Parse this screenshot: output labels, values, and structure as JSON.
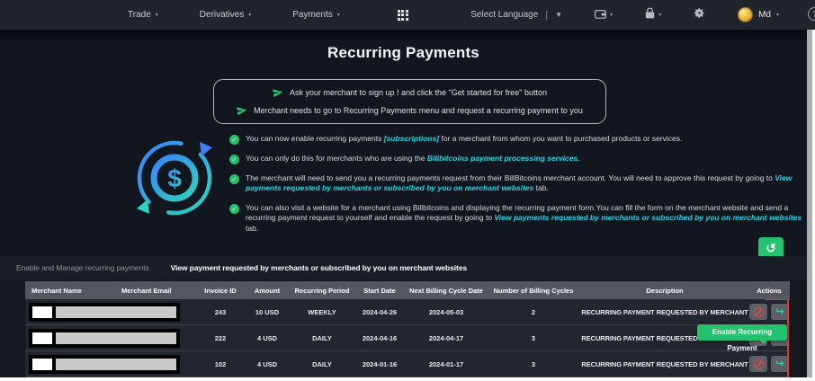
{
  "colors": {
    "accent_cyan": "#1fd5e8",
    "green": "#25c16f",
    "red": "#e24b4b",
    "navbar_bg": "#20252c",
    "main_bg": "#12161f",
    "table_header_bg": "#54585e",
    "row_bg": "#22262e"
  },
  "icons": {
    "apps-grid-icon": "3x3-grid",
    "wallet-icon": "wallet",
    "lock-icon": "padlock",
    "settings-gear-icon": "gear",
    "help-icon": "question-circle",
    "paper-plane-icon": "paper-plane",
    "check-icon": "✓",
    "history-icon": "↺",
    "ban-icon": "⊘",
    "forward-arrow-icon": "↪",
    "recurring-dollar-icon": "dollar-cycle",
    "caret-down-icon": "▾"
  },
  "navbar": {
    "items": [
      {
        "label": "Trade"
      },
      {
        "label": "Derivatives"
      },
      {
        "label": "Payments"
      }
    ],
    "language_label": "Select Language",
    "language_divider": "|",
    "user_label": "Md",
    "help_label": "?"
  },
  "page": {
    "title": "Recurring Payments"
  },
  "infobox": {
    "lines": [
      "Ask your merchant to sign up ! and click the \"Get started for free\" button",
      "Merchant needs to go to Recurring Payments menu and request a recurring payment to you"
    ]
  },
  "bullets": [
    {
      "segments": [
        {
          "text": "You can now enable recurring payments "
        },
        {
          "text": "[subscriptions]",
          "accent": true
        },
        {
          "text": " for a merchant from whom you want to purchased products or services."
        }
      ]
    },
    {
      "segments": [
        {
          "text": "You can only do this for merchants who are using the "
        },
        {
          "text": "Billbitcoins payment processing services.",
          "accent": true
        },
        {
          "text": ""
        }
      ]
    },
    {
      "segments": [
        {
          "text": "The merchant will need to send you a recurring payments request from their BillBitcoins merchant account. You will need to approve this request by going to "
        },
        {
          "text": "View payments requested by merchants or subscribed by you on merchant websites",
          "accent": true
        },
        {
          "text": " tab."
        }
      ]
    },
    {
      "segments": [
        {
          "text": "You can also visit a website for a merchant using Billbitcoins and displaying the recurring payment form.You can fill the form on the merchant website and send a recurring payment request to yourself and enable the request by going to "
        },
        {
          "text": "View payments requested by merchants or subscribed by you on merchant websites",
          "accent": true
        },
        {
          "text": " tab."
        }
      ]
    }
  ],
  "tabs": [
    {
      "label": "Enable and Manage recurring payments"
    },
    {
      "label": "View payment requested by merchants or subscribed by you on merchant websites"
    }
  ],
  "tooltip": {
    "text": "Enable Recurring Payment"
  },
  "table": {
    "headers": [
      "Merchant Name",
      "Merchant Email",
      "Invoice ID",
      "Amount",
      "Recurring Period",
      "Start Date",
      "Next Billing Cycle Date",
      "Number of Billing Cycles",
      "Description",
      "Actions"
    ],
    "rows": [
      {
        "merchant_name": "",
        "merchant_email": "",
        "redacted": true,
        "invoice_id": "243",
        "amount": "10 USD",
        "recurring_period": "WEEKLY",
        "start_date": "2024-04-26",
        "next_billing_cycle_date": "2024-05-03",
        "number_of_billing_cycles": "2",
        "description": "RECURRING PAYMENT REQUESTED BY MERCHANT"
      },
      {
        "merchant_name": "",
        "merchant_email": "",
        "redacted": true,
        "invoice_id": "222",
        "amount": "4 USD",
        "recurring_period": "DAILY",
        "start_date": "2024-04-16",
        "next_billing_cycle_date": "2024-04-17",
        "number_of_billing_cycles": "3",
        "description": "RECURRING PAYMENT REQUESTED BY MERCHANT"
      },
      {
        "merchant_name": "",
        "merchant_email": "",
        "redacted": true,
        "invoice_id": "102",
        "amount": "4 USD",
        "recurring_period": "DAILY",
        "start_date": "2024-01-16",
        "next_billing_cycle_date": "2024-01-17",
        "number_of_billing_cycles": "3",
        "description": "RECURRING PAYMENT REQUESTED BY MERCHANT"
      }
    ]
  }
}
